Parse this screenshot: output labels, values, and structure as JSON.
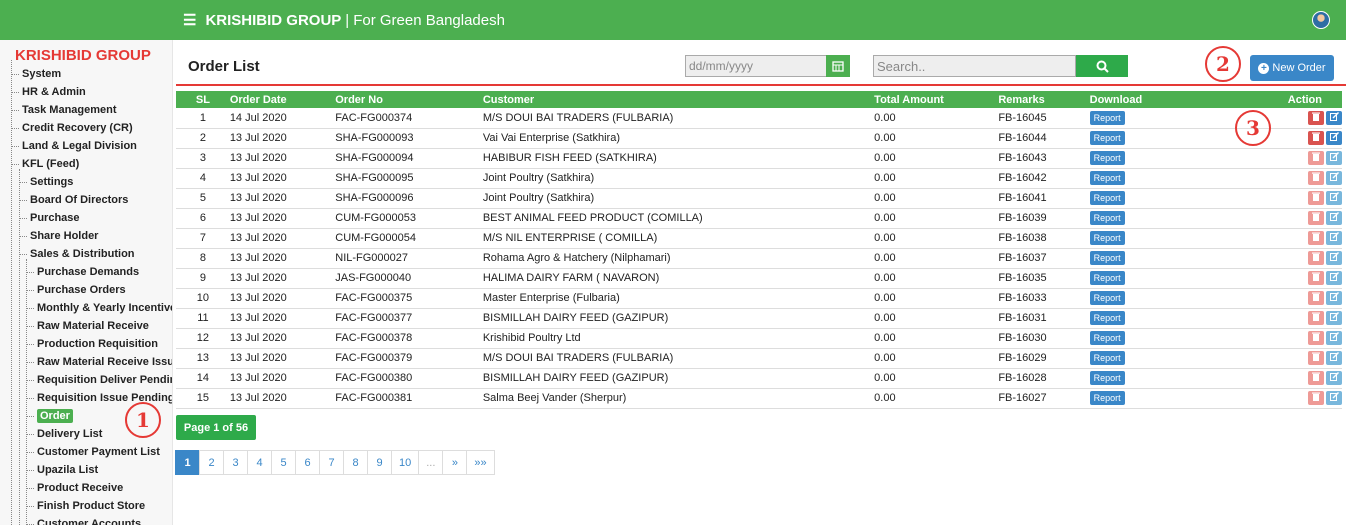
{
  "topbar": {
    "menu_icon": "☰",
    "brand": "KRISHIBID GROUP",
    "separator": "|",
    "tagline": "For Green Bangladesh"
  },
  "sidebar": {
    "title": "KRISHIBID GROUP",
    "top_items": [
      "System",
      "HR & Admin",
      "Task Management",
      "Credit Recovery (CR)",
      "Land & Legal Division",
      "KFL (Feed)"
    ],
    "kfl_items": [
      "Settings",
      "Board Of Directors",
      "Purchase",
      "Share Holder",
      "Sales & Distribution"
    ],
    "sales_items": [
      "Purchase Demands",
      "Purchase Orders",
      "Monthly & Yearly Incentive",
      "Raw Material Receive",
      "Production Requisition",
      "Raw Material Receive Issue",
      "Requisition Deliver Pending",
      "Requisition Issue Pending",
      "Order",
      "Delivery List",
      "Customer Payment List",
      "Upazila List",
      "Product Receive",
      "Finish Product Store",
      "Customer Accounts"
    ],
    "active_item": "Order"
  },
  "header": {
    "title": "Order List",
    "date_placeholder": "dd/mm/yyyy",
    "search_placeholder": "Search..",
    "new_order_label": "New Order"
  },
  "table": {
    "columns": [
      "SL",
      "Order Date",
      "Order No",
      "Customer",
      "Total Amount",
      "Remarks",
      "Download",
      "Action"
    ],
    "report_label": "Report",
    "rows": [
      [
        "1",
        "14 Jul 2020",
        "FAC-FG000374",
        "M/S DOUI BAI TRADERS (FULBARIA)",
        "0.00",
        "FB-16045"
      ],
      [
        "2",
        "13 Jul 2020",
        "SHA-FG000093",
        "Vai Vai Enterprise (Satkhira)",
        "0.00",
        "FB-16044"
      ],
      [
        "3",
        "13 Jul 2020",
        "SHA-FG000094",
        "HABIBUR FISH FEED (SATKHIRA)",
        "0.00",
        "FB-16043"
      ],
      [
        "4",
        "13 Jul 2020",
        "SHA-FG000095",
        "Joint Poultry (Satkhira)",
        "0.00",
        "FB-16042"
      ],
      [
        "5",
        "13 Jul 2020",
        "SHA-FG000096",
        "Joint Poultry (Satkhira)",
        "0.00",
        "FB-16041"
      ],
      [
        "6",
        "13 Jul 2020",
        "CUM-FG000053",
        "BEST ANIMAL FEED PRODUCT (COMILLA)",
        "0.00",
        "FB-16039"
      ],
      [
        "7",
        "13 Jul 2020",
        "CUM-FG000054",
        "M/S NIL ENTERPRISE ( COMILLA)",
        "0.00",
        "FB-16038"
      ],
      [
        "8",
        "13 Jul 2020",
        "NIL-FG000027",
        "Rohama Agro & Hatchery (Nilphamari)",
        "0.00",
        "FB-16037"
      ],
      [
        "9",
        "13 Jul 2020",
        "JAS-FG000040",
        "HALIMA DAIRY FARM ( NAVARON)",
        "0.00",
        "FB-16035"
      ],
      [
        "10",
        "13 Jul 2020",
        "FAC-FG000375",
        "Master Enterprise (Fulbaria)",
        "0.00",
        "FB-16033"
      ],
      [
        "11",
        "13 Jul 2020",
        "FAC-FG000377",
        "BISMILLAH DAIRY FEED (GAZIPUR)",
        "0.00",
        "FB-16031"
      ],
      [
        "12",
        "13 Jul 2020",
        "FAC-FG000378",
        "Krishibid Poultry Ltd",
        "0.00",
        "FB-16030"
      ],
      [
        "13",
        "13 Jul 2020",
        "FAC-FG000379",
        "M/S DOUI BAI TRADERS (FULBARIA)",
        "0.00",
        "FB-16029"
      ],
      [
        "14",
        "13 Jul 2020",
        "FAC-FG000380",
        "BISMILLAH DAIRY FEED (GAZIPUR)",
        "0.00",
        "FB-16028"
      ],
      [
        "15",
        "13 Jul 2020",
        "FAC-FG000381",
        "Salma Beej Vander (Sherpur)",
        "0.00",
        "FB-16027"
      ]
    ]
  },
  "pagination": {
    "info": "Page 1 of 56",
    "pages": [
      "1",
      "2",
      "3",
      "4",
      "5",
      "6",
      "7",
      "8",
      "9",
      "10",
      "...",
      "»",
      "»»"
    ],
    "current": "1"
  },
  "annotations": [
    "1",
    "2",
    "3"
  ]
}
